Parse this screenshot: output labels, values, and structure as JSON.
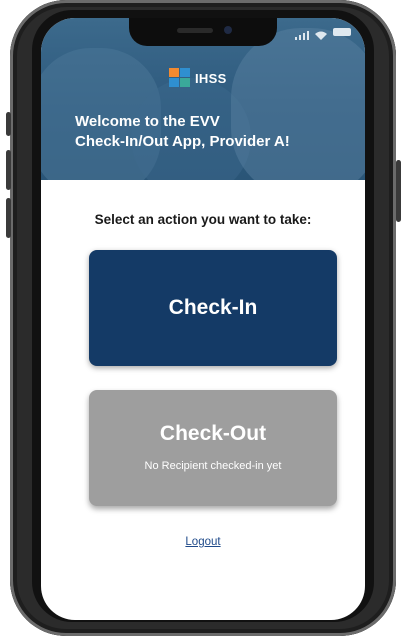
{
  "status_bar": {
    "icons": [
      "signal-icon",
      "wifi-icon",
      "battery-icon"
    ]
  },
  "header": {
    "logo_text": "IHSS",
    "welcome_line1": "Welcome to the EVV",
    "welcome_line2": "Check-In/Out App, Provider A!"
  },
  "main": {
    "prompt": "Select an action you want to take:",
    "checkin": {
      "label": "Check-In"
    },
    "checkout": {
      "label": "Check-Out",
      "sublabel": "No Recipient checked-in yet"
    },
    "logout_label": "Logout"
  },
  "colors": {
    "checkin_bg": "#143a66",
    "checkout_bg": "#9e9e9e",
    "header_bg": "#2e5a7e",
    "link": "#1f4a8a",
    "logo_orange": "#f28a30",
    "logo_blue": "#2f8fd0",
    "logo_green": "#3aa89a"
  }
}
